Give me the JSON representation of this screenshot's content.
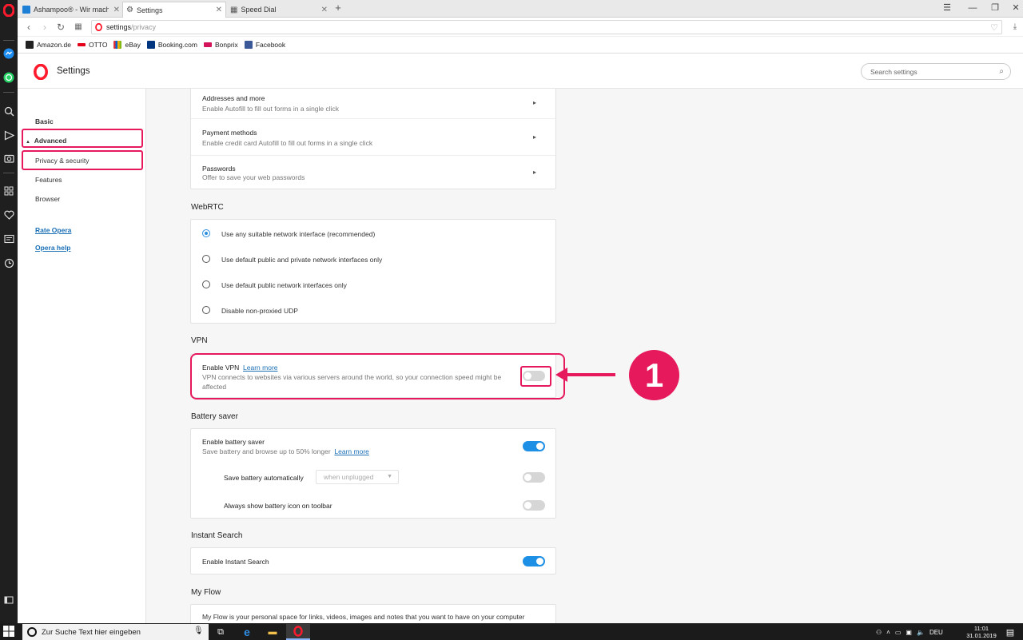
{
  "browser": {
    "tabs": [
      {
        "title": "Ashampoo® - Wir machen",
        "active": false,
        "favicon": "ashampoo-icon"
      },
      {
        "title": "Settings",
        "active": true,
        "favicon": "gear-icon"
      },
      {
        "title": "Speed Dial",
        "active": false,
        "favicon": "grid-icon"
      }
    ],
    "url_host": "settings",
    "url_path": "/privacy",
    "bookmarks": [
      {
        "label": "Amazon.de",
        "icon": "amazon-icon",
        "color": "#222222"
      },
      {
        "label": "OTTO",
        "icon": "otto-icon",
        "color": "#e2001a"
      },
      {
        "label": "eBay",
        "icon": "ebay-icon",
        "color": "#f5af02"
      },
      {
        "label": "Booking.com",
        "icon": "booking-icon",
        "color": "#003580"
      },
      {
        "label": "Bonprix",
        "icon": "bonprix-icon",
        "color": "#d4145a"
      },
      {
        "label": "Facebook",
        "icon": "facebook-icon",
        "color": "#3b5998"
      }
    ]
  },
  "settings": {
    "title": "Settings",
    "search_placeholder": "Search settings",
    "nav": {
      "basic": "Basic",
      "advanced": "Advanced",
      "privacy": "Privacy & security",
      "features": "Features",
      "browser": "Browser",
      "rate": "Rate Opera",
      "help": "Opera help"
    },
    "autofill": [
      {
        "title": "Addresses and more",
        "subtitle": "Enable Autofill to fill out forms in a single click"
      },
      {
        "title": "Payment methods",
        "subtitle": "Enable credit card Autofill to fill out forms in a single click"
      },
      {
        "title": "Passwords",
        "subtitle": "Offer to save your web passwords"
      }
    ],
    "webrtc": {
      "title": "WebRTC",
      "options": [
        "Use any suitable network interface (recommended)",
        "Use default public and private network interfaces only",
        "Use default public network interfaces only",
        "Disable non-proxied UDP"
      ],
      "selected_index": 0
    },
    "vpn": {
      "title": "VPN",
      "enable_label": "Enable VPN",
      "learn_more": "Learn more",
      "description_line1": "VPN connects to websites via various servers around the world, so your connection speed might be",
      "description_line2": "affected",
      "enabled": false
    },
    "battery": {
      "title": "Battery saver",
      "enable_label": "Enable battery saver",
      "subtitle": "Save battery and browse up to 50% longer",
      "learn_more": "Learn more",
      "enabled": true,
      "auto_label": "Save battery automatically",
      "auto_select_value": "when unplugged",
      "auto_enabled": false,
      "icon_label": "Always show battery icon on toolbar",
      "icon_enabled": false
    },
    "instant_search": {
      "title": "Instant Search",
      "enable_label": "Enable Instant Search",
      "enabled": true
    },
    "my_flow": {
      "title": "My Flow",
      "description": "My Flow is your personal space for links, videos, images and notes that you want to have on your computer"
    }
  },
  "annotation": {
    "number": "1",
    "color": "#e6195c"
  },
  "taskbar": {
    "search_placeholder": "Zur Suche Text hier eingeben",
    "language": "DEU",
    "time": "11:01",
    "date": "31.01.2019"
  }
}
